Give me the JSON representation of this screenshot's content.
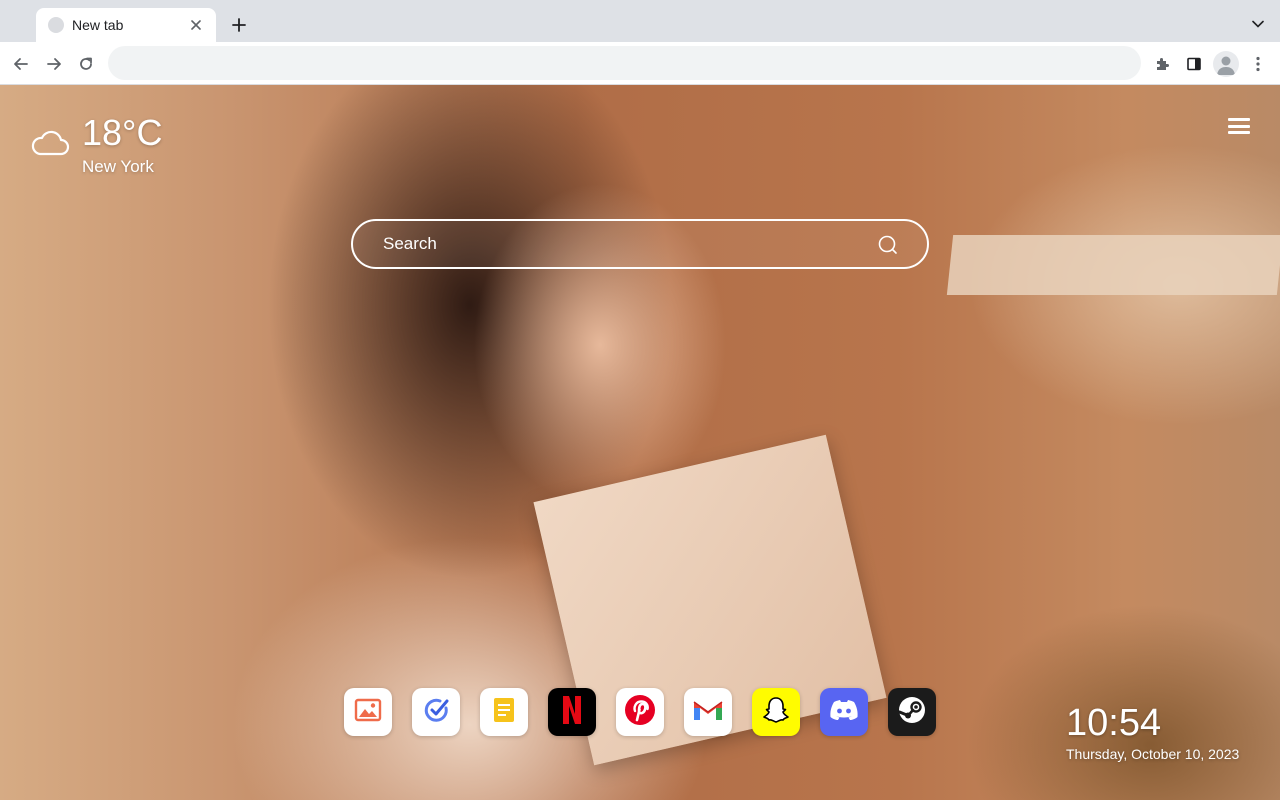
{
  "browser": {
    "tab_title": "New tab",
    "address_value": "",
    "icons": {
      "back": "arrow-left-icon",
      "forward": "arrow-right-icon",
      "reload": "reload-icon",
      "extensions": "puzzle-icon",
      "side_panel": "side-panel-icon",
      "profile": "profile-icon",
      "menu": "kebab-menu-icon",
      "new_tab": "plus-icon",
      "tab_search": "chevron-down-icon"
    }
  },
  "weather": {
    "temperature": "18°C",
    "city": "New York",
    "icon": "cloud-icon"
  },
  "search": {
    "placeholder": "Search"
  },
  "shortcuts": [
    {
      "name": "gallery",
      "icon": "image-icon",
      "bg": "#ffffff"
    },
    {
      "name": "tasks",
      "icon": "check-circle-icon",
      "bg": "#ffffff"
    },
    {
      "name": "notes",
      "icon": "note-icon",
      "bg": "#ffffff"
    },
    {
      "name": "netflix",
      "icon": "netflix-icon",
      "bg": "#000000"
    },
    {
      "name": "pinterest",
      "icon": "pinterest-icon",
      "bg": "#ffffff"
    },
    {
      "name": "gmail",
      "icon": "gmail-icon",
      "bg": "#ffffff"
    },
    {
      "name": "snapchat",
      "icon": "snapchat-icon",
      "bg": "#fffc00"
    },
    {
      "name": "discord",
      "icon": "discord-icon",
      "bg": "#5865f2"
    },
    {
      "name": "steam",
      "icon": "steam-icon",
      "bg": "#1b1b1b"
    }
  ],
  "clock": {
    "time": "10:54",
    "date": "Thursday, October 10, 2023"
  },
  "colors": {
    "chrome_bg": "#dee1e6",
    "omnibox_bg": "#f1f3f4",
    "netflix_red": "#e50914",
    "pinterest_red": "#e60023",
    "discord_blurple": "#5865f2",
    "snapchat_yellow": "#fffc00"
  }
}
